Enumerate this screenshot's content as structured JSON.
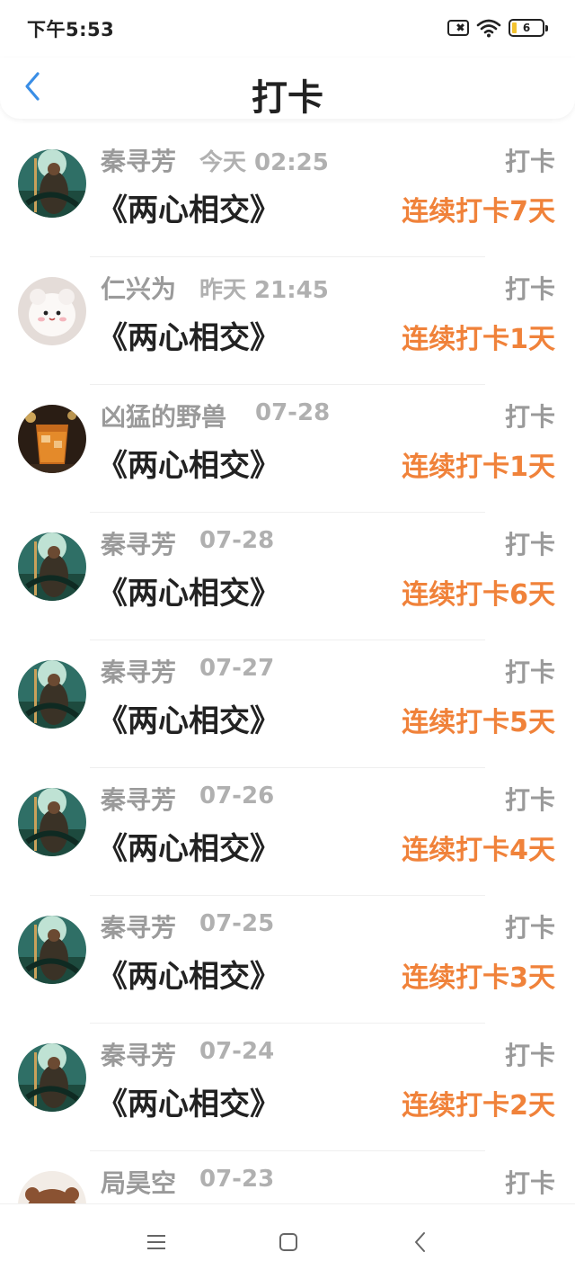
{
  "status_bar": {
    "time": "下午5:53",
    "battery": "6"
  },
  "header": {
    "title": "打卡"
  },
  "items": [
    {
      "name": "秦寻芳",
      "time": "今天 02:25",
      "type": "打卡",
      "title": "《两心相交》",
      "streak": "连续打卡7天",
      "avatar": "warrior"
    },
    {
      "name": "仁兴为",
      "time": "昨天 21:45",
      "type": "打卡",
      "title": "《两心相交》",
      "streak": "连续打卡1天",
      "avatar": "plush"
    },
    {
      "name": "凶猛的野兽",
      "time": "07-28",
      "type": "打卡",
      "title": "《两心相交》",
      "streak": "连续打卡1天",
      "avatar": "drink"
    },
    {
      "name": "秦寻芳",
      "time": "07-28",
      "type": "打卡",
      "title": "《两心相交》",
      "streak": "连续打卡6天",
      "avatar": "warrior"
    },
    {
      "name": "秦寻芳",
      "time": "07-27",
      "type": "打卡",
      "title": "《两心相交》",
      "streak": "连续打卡5天",
      "avatar": "warrior"
    },
    {
      "name": "秦寻芳",
      "time": "07-26",
      "type": "打卡",
      "title": "《两心相交》",
      "streak": "连续打卡4天",
      "avatar": "warrior"
    },
    {
      "name": "秦寻芳",
      "time": "07-25",
      "type": "打卡",
      "title": "《两心相交》",
      "streak": "连续打卡3天",
      "avatar": "warrior"
    },
    {
      "name": "秦寻芳",
      "time": "07-24",
      "type": "打卡",
      "title": "《两心相交》",
      "streak": "连续打卡2天",
      "avatar": "warrior"
    },
    {
      "name": "局昊空",
      "time": "07-23",
      "type": "打卡",
      "title": "",
      "streak": "",
      "avatar": "bear"
    }
  ],
  "colors": {
    "accent": "#f0823a",
    "back_icon": "#3a8ee6"
  },
  "icons": {
    "back": "chevron-left-icon",
    "nav_menu": "menu-icon",
    "nav_home": "square-home-icon",
    "nav_back": "chevron-left-icon"
  }
}
